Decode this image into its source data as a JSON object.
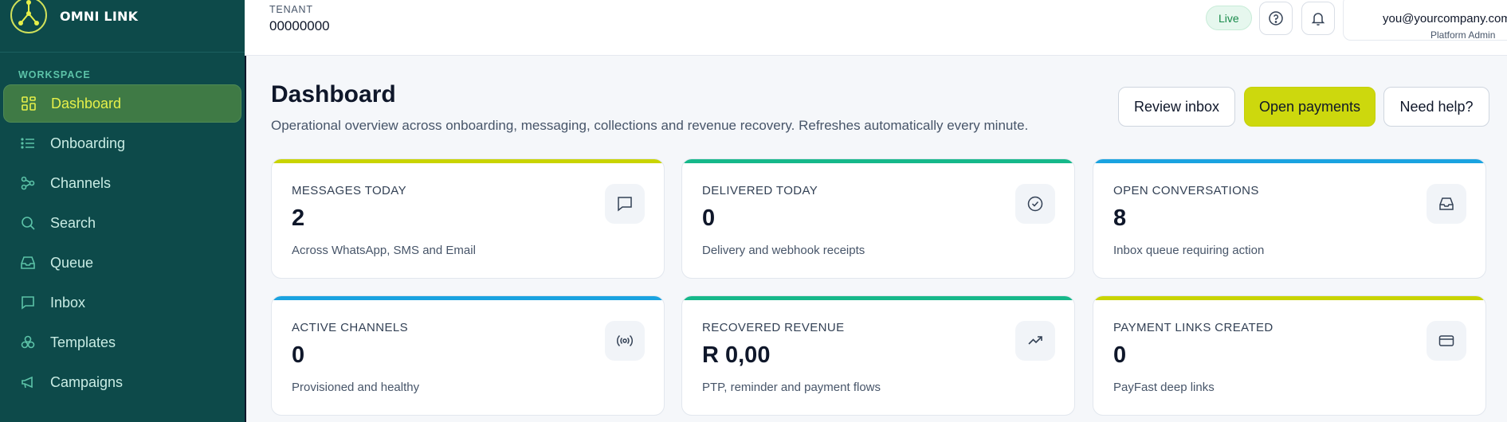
{
  "brand": {
    "name": "OMNI LINK",
    "logo_icon": "network-logo-icon"
  },
  "sidebar": {
    "section_label": "WORKSPACE",
    "items": [
      {
        "label": "Dashboard",
        "icon": "grid-icon",
        "active": true
      },
      {
        "label": "Onboarding",
        "icon": "list-icon"
      },
      {
        "label": "Channels",
        "icon": "share-nodes-icon"
      },
      {
        "label": "Search",
        "icon": "search-icon"
      },
      {
        "label": "Queue",
        "icon": "inbox-tray-icon"
      },
      {
        "label": "Inbox",
        "icon": "message-square-icon"
      },
      {
        "label": "Templates",
        "icon": "shapes-icon"
      },
      {
        "label": "Campaigns",
        "icon": "megaphone-icon"
      }
    ]
  },
  "topbar": {
    "tenant_label": "TENANT",
    "tenant_value": "00000000",
    "status": "Live",
    "user_email": "you@yourcompany.com",
    "user_role": "Platform Admin"
  },
  "page": {
    "title": "Dashboard",
    "subtitle": "Operational overview across onboarding, messaging, collections and revenue recovery. Refreshes automatically every minute.",
    "actions": {
      "review": "Review inbox",
      "payments": "Open payments",
      "help": "Need help?"
    }
  },
  "colors": {
    "lime": "#c9d400",
    "green": "#16b88a",
    "blue": "#1aa3e0"
  },
  "cards": [
    {
      "label": "MESSAGES TODAY",
      "value": "2",
      "desc": "Across WhatsApp, SMS and Email",
      "icon": "chat-bubble-icon",
      "accent": "#c9d400"
    },
    {
      "label": "DELIVERED TODAY",
      "value": "0",
      "desc": "Delivery and webhook receipts",
      "icon": "check-circle-icon",
      "accent": "#16b88a"
    },
    {
      "label": "OPEN CONVERSATIONS",
      "value": "8",
      "desc": "Inbox queue requiring action",
      "icon": "inbox-icon",
      "accent": "#1aa3e0"
    },
    {
      "label": "ACTIVE CHANNELS",
      "value": "0",
      "desc": "Provisioned and healthy",
      "icon": "broadcast-icon",
      "accent": "#1aa3e0"
    },
    {
      "label": "RECOVERED REVENUE",
      "value": "R 0,00",
      "desc": "PTP, reminder and payment flows",
      "icon": "trending-up-icon",
      "accent": "#16b88a"
    },
    {
      "label": "PAYMENT LINKS CREATED",
      "value": "0",
      "desc": "PayFast deep links",
      "icon": "credit-card-icon",
      "accent": "#c9d400"
    }
  ]
}
